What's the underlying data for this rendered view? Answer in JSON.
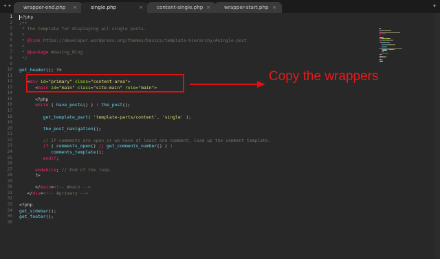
{
  "tabs": [
    {
      "label": "wrapper-end.php",
      "close": "×",
      "active": false
    },
    {
      "label": "single.php",
      "close": "×",
      "active": true
    },
    {
      "label": "content-single.php",
      "close": "×",
      "active": false
    },
    {
      "label": "wrapper-start.php",
      "close": "×",
      "active": false
    }
  ],
  "nav_arrows": "◂ ▸",
  "tab_menu": "▾",
  "current_line": 1,
  "line_numbers": [
    "1",
    "2",
    "3",
    "4",
    "5",
    "6",
    "7",
    "8",
    "9",
    "10",
    "11",
    "12",
    "13",
    "14",
    "15",
    "16",
    "17",
    "18",
    "19",
    "20",
    "21",
    "22",
    "23",
    "24",
    "25",
    "26",
    "27",
    "28",
    "29",
    "30",
    "31",
    "32",
    "33",
    "34",
    "35",
    "36"
  ],
  "code_lines": [
    [
      {
        "t": "<?php",
        "c": "pl"
      }
    ],
    [
      {
        "t": "/**",
        "c": "com"
      }
    ],
    [
      {
        "t": " * The template for displaying all single posts.",
        "c": "com"
      }
    ],
    [
      {
        "t": " *",
        "c": "com"
      }
    ],
    [
      {
        "t": " * ",
        "c": "com"
      },
      {
        "t": "@link",
        "c": "kw"
      },
      {
        "t": " https://developer.wordpress.org/themes/basics/template-hierarchy/#single-post",
        "c": "com"
      }
    ],
    [
      {
        "t": " *",
        "c": "com"
      }
    ],
    [
      {
        "t": " * ",
        "c": "com"
      },
      {
        "t": "@package",
        "c": "kw"
      },
      {
        "t": " Amazing_Blog",
        "c": "com"
      }
    ],
    [
      {
        "t": " */",
        "c": "com"
      }
    ],
    [],
    [
      {
        "t": "get_header",
        "c": "fn"
      },
      {
        "t": "(); ?>",
        "c": "pl"
      }
    ],
    [],
    [
      {
        "t": "   <",
        "c": "pl"
      },
      {
        "t": "div",
        "c": "tag"
      },
      {
        "t": " id",
        "c": "attr"
      },
      {
        "t": "=",
        "c": "pl"
      },
      {
        "t": "\"primary\"",
        "c": "str"
      },
      {
        "t": " class",
        "c": "attr"
      },
      {
        "t": "=",
        "c": "pl"
      },
      {
        "t": "\"content-area\"",
        "c": "str"
      },
      {
        "t": ">",
        "c": "pl"
      }
    ],
    [
      {
        "t": "      <",
        "c": "pl"
      },
      {
        "t": "main",
        "c": "tag"
      },
      {
        "t": " id",
        "c": "attr"
      },
      {
        "t": "=",
        "c": "pl"
      },
      {
        "t": "\"main\"",
        "c": "str"
      },
      {
        "t": " class",
        "c": "attr"
      },
      {
        "t": "=",
        "c": "pl"
      },
      {
        "t": "\"site-main\"",
        "c": "str"
      },
      {
        "t": " role",
        "c": "attr"
      },
      {
        "t": "=",
        "c": "pl"
      },
      {
        "t": "\"main\"",
        "c": "str"
      },
      {
        "t": ">",
        "c": "pl"
      }
    ],
    [],
    [
      {
        "t": "      <?php",
        "c": "pl"
      }
    ],
    [
      {
        "t": "      ",
        "c": "pl"
      },
      {
        "t": "while",
        "c": "kw"
      },
      {
        "t": " ( ",
        "c": "pl"
      },
      {
        "t": "have_posts",
        "c": "fn"
      },
      {
        "t": "() ) : ",
        "c": "pl"
      },
      {
        "t": "the_post",
        "c": "fn"
      },
      {
        "t": "();",
        "c": "pl"
      }
    ],
    [],
    [
      {
        "t": "         ",
        "c": "pl"
      },
      {
        "t": "get_template_part",
        "c": "fn"
      },
      {
        "t": "( ",
        "c": "pl"
      },
      {
        "t": "'template-parts/content'",
        "c": "str"
      },
      {
        "t": ", ",
        "c": "pl"
      },
      {
        "t": "'single'",
        "c": "str"
      },
      {
        "t": " );",
        "c": "pl"
      }
    ],
    [],
    [
      {
        "t": "         ",
        "c": "pl"
      },
      {
        "t": "the_post_navigation",
        "c": "fn"
      },
      {
        "t": "();",
        "c": "pl"
      }
    ],
    [],
    [
      {
        "t": "         // If comments are open or we have at least one comment, load up the comment template.",
        "c": "com"
      }
    ],
    [
      {
        "t": "         ",
        "c": "pl"
      },
      {
        "t": "if",
        "c": "kw"
      },
      {
        "t": " ( ",
        "c": "pl"
      },
      {
        "t": "comments_open",
        "c": "fn"
      },
      {
        "t": "() ",
        "c": "pl"
      },
      {
        "t": "||",
        "c": "kw"
      },
      {
        "t": " ",
        "c": "pl"
      },
      {
        "t": "get_comments_number",
        "c": "fn"
      },
      {
        "t": "() ) :",
        "c": "pl"
      }
    ],
    [
      {
        "t": "            ",
        "c": "pl"
      },
      {
        "t": "comments_template",
        "c": "fn"
      },
      {
        "t": "();",
        "c": "pl"
      }
    ],
    [
      {
        "t": "         ",
        "c": "pl"
      },
      {
        "t": "endif",
        "c": "kw"
      },
      {
        "t": ";",
        "c": "pl"
      }
    ],
    [],
    [
      {
        "t": "      ",
        "c": "pl"
      },
      {
        "t": "endwhile",
        "c": "kw"
      },
      {
        "t": "; ",
        "c": "pl"
      },
      {
        "t": "// End of the loop.",
        "c": "com"
      }
    ],
    [
      {
        "t": "      ?>",
        "c": "pl"
      }
    ],
    [],
    [
      {
        "t": "      </",
        "c": "pl"
      },
      {
        "t": "main",
        "c": "tag"
      },
      {
        "t": ">",
        "c": "pl"
      },
      {
        "t": "<!-- #main -->",
        "c": "com"
      }
    ],
    [
      {
        "t": "   </",
        "c": "pl"
      },
      {
        "t": "div",
        "c": "tag"
      },
      {
        "t": ">",
        "c": "pl"
      },
      {
        "t": "<!-- #primary -->",
        "c": "com"
      }
    ],
    [],
    [
      {
        "t": "<?php",
        "c": "pl"
      }
    ],
    [
      {
        "t": "get_sidebar",
        "c": "fn"
      },
      {
        "t": "();",
        "c": "pl"
      }
    ],
    [
      {
        "t": "get_footer",
        "c": "fn"
      },
      {
        "t": "();",
        "c": "pl"
      }
    ],
    []
  ],
  "annotation": {
    "text": "Copy the wrappers",
    "color": "#e81a1a"
  },
  "colors": {
    "keyword": "#f92672",
    "function": "#66d9ef",
    "string": "#e6db74",
    "comment": "#75715e",
    "attribute": "#a6e22e",
    "background": "#282828"
  }
}
